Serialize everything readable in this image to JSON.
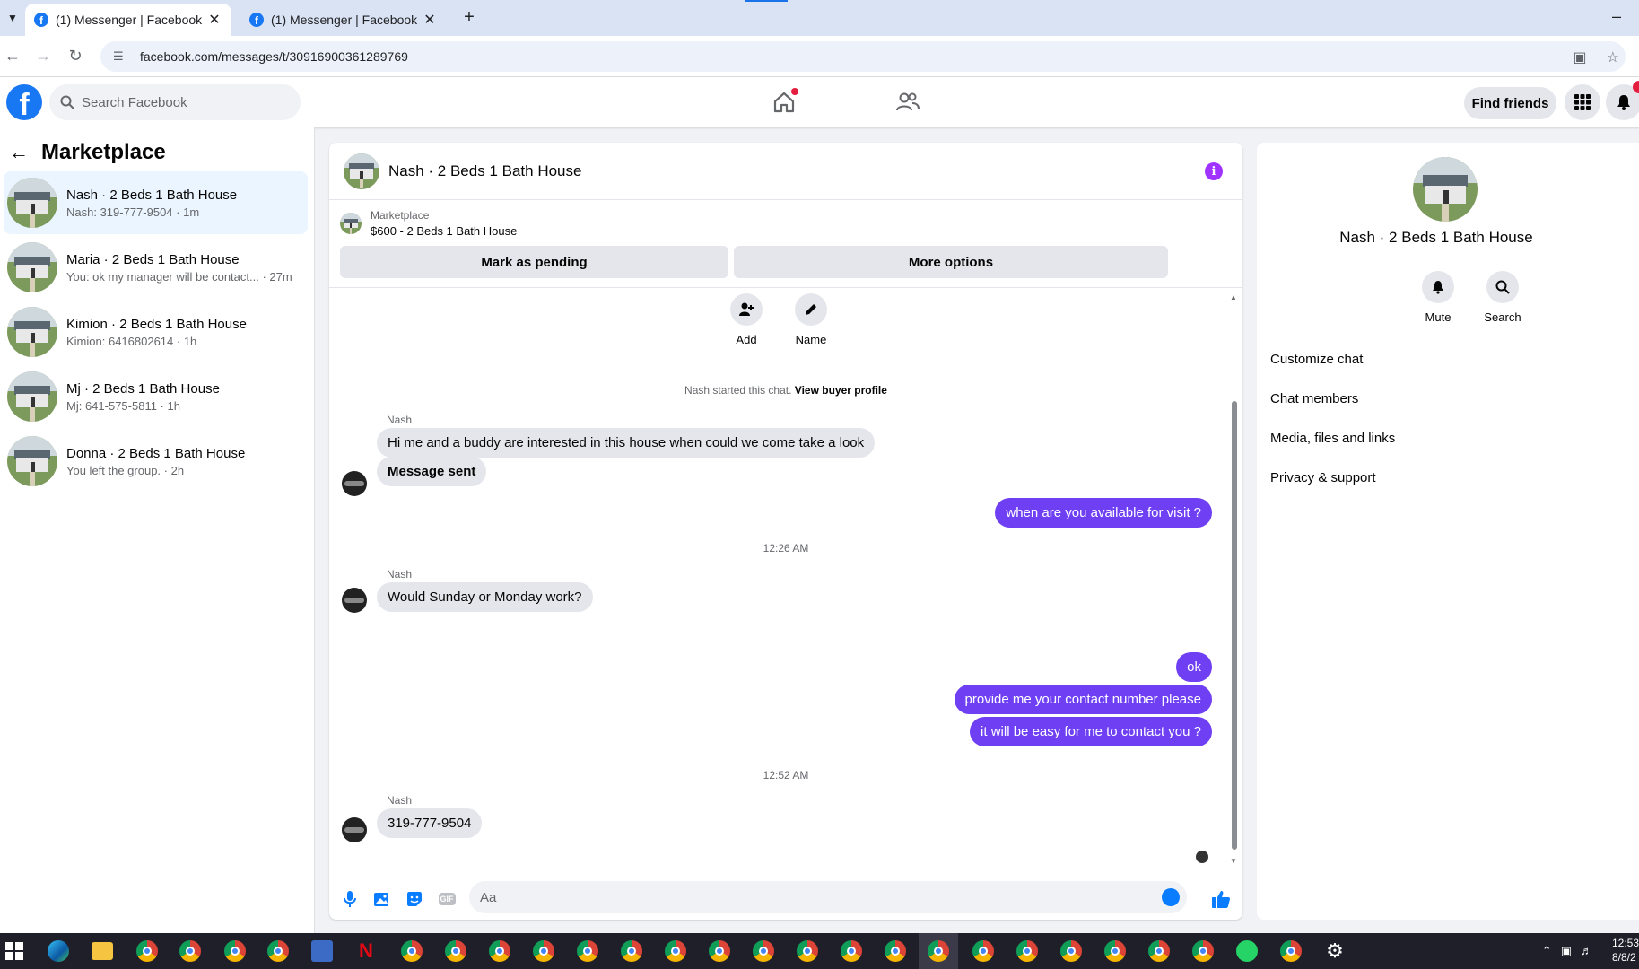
{
  "browser": {
    "tabs": [
      {
        "title": "(1) Messenger | Facebook",
        "close": "✕"
      },
      {
        "title": "(1) Messenger | Facebook",
        "close": "✕"
      }
    ],
    "new_tab": "+",
    "minimize": "–",
    "url": "facebook.com/messages/t/30916900361289769"
  },
  "fb_header": {
    "logo": "f",
    "search_placeholder": "Search Facebook",
    "find_friends": "Find friends"
  },
  "left": {
    "title": "Marketplace",
    "conversations": [
      {
        "name": "Nash · 2 Beds 1 Bath House",
        "preview": "Nash: 319-777-9504 · 1m",
        "active": true
      },
      {
        "name": "Maria · 2 Beds 1 Bath House",
        "preview": "You: ok my manager will be contact... · 27m",
        "active": false
      },
      {
        "name": "Kimion · 2 Beds 1 Bath House",
        "preview": "Kimion: 6416802614 · 1h",
        "active": false
      },
      {
        "name": "Mj · 2 Beds 1 Bath House",
        "preview": "Mj: 641-575-5811 · 1h",
        "active": false
      },
      {
        "name": "Donna · 2 Beds 1 Bath House",
        "preview": "You left the group. · 2h",
        "active": false
      }
    ]
  },
  "chat": {
    "title": "Nash · 2 Beds 1 Bath House",
    "listing_label": "Marketplace",
    "listing_detail": "$600 - 2 Beds 1 Bath House",
    "mark_pending": "Mark as pending",
    "more_options": "More options",
    "quick_add": "Add",
    "quick_name": "Name",
    "system_text": "Nash started this chat.",
    "system_link": "View buyer profile",
    "messages": {
      "sender1": "Nash",
      "m1": "Hi me and a buddy are interested in this house when could we come take a look",
      "m2": "Message sent",
      "m3": "when are you available for visit ?",
      "time1": "12:26 AM",
      "sender2": "Nash",
      "m4": "Would Sunday or Monday work?",
      "m5": "ok",
      "m6": "provide me your contact number please",
      "m7": "it will be easy for me to contact you ?",
      "time2": "12:52 AM",
      "sender3": "Nash",
      "m8": "319-777-9504"
    },
    "composer_placeholder": "Aa",
    "gif_label": "GIF",
    "outgoing_color": "#6e3ff3"
  },
  "right": {
    "name": "Nash · 2 Beds 1 Bath House",
    "mute": "Mute",
    "search": "Search",
    "items": [
      "Customize chat",
      "Chat members",
      "Media, files and links",
      "Privacy & support"
    ]
  },
  "taskbar": {
    "clock_time": "12:53",
    "clock_date": "8/8/2"
  }
}
